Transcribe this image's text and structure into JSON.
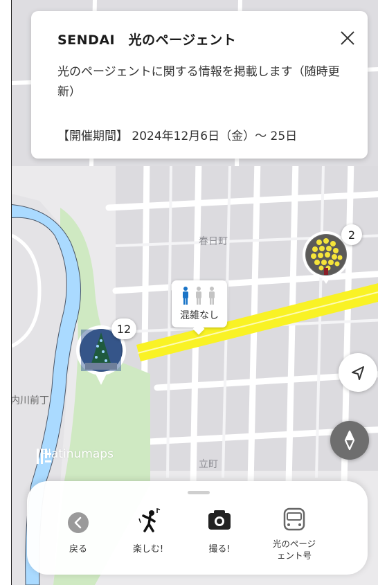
{
  "event": {
    "title": "SENDAI　光のページェント",
    "description": "光のページェントに関する情報を掲載します（随時更新）",
    "period": "【開催期間】 2024年12月6日（金）～ 25日"
  },
  "map_labels": {
    "kasugamachi": "春日町",
    "uchikawa": "内川前丁",
    "tachimachi": "立町"
  },
  "markers": {
    "tree_cluster_count": "2",
    "photo_cluster_count": "12"
  },
  "crowd": {
    "label": "混雑なし",
    "level": 0
  },
  "brand": {
    "name": "Platinumaps"
  },
  "nav": {
    "back": "戻る",
    "enjoy": "楽しむ!",
    "shoot": "撮る!",
    "bus": "光のページェント号"
  },
  "colors": {
    "route": "#f9f225",
    "river": "#aadaff",
    "park": "#cfe9c2",
    "compass_fab": "#6e6e6e",
    "crowd_active": "#1a74c7",
    "crowd_inactive": "#c4c4c4"
  }
}
